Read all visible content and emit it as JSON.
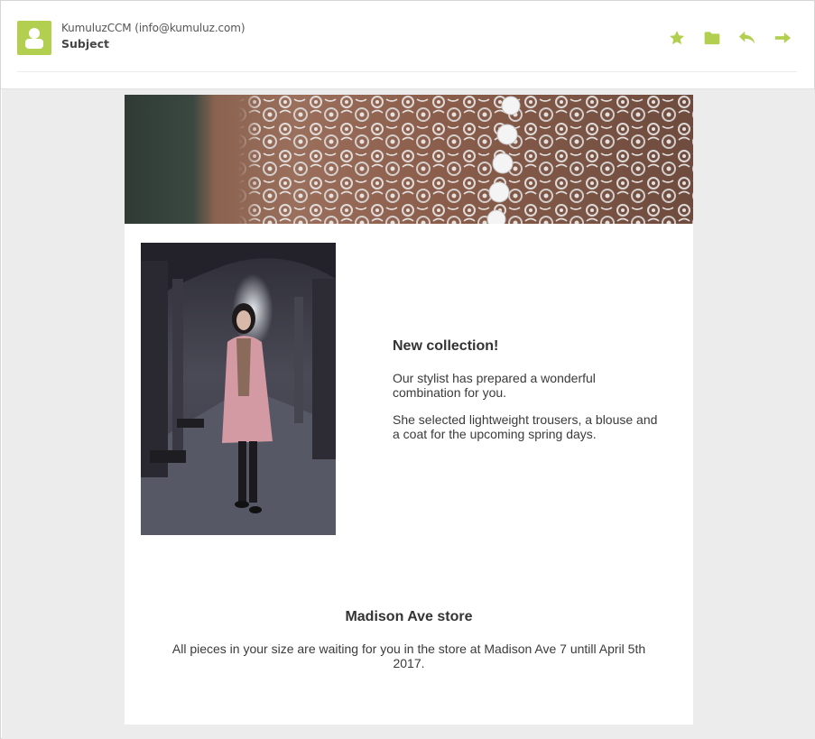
{
  "header": {
    "sender": "KumuluzCCM (info@kumuluz.com)",
    "subject": "Subject",
    "actions": [
      {
        "icon": "star-icon"
      },
      {
        "icon": "folder-icon"
      },
      {
        "icon": "reply-icon"
      },
      {
        "icon": "forward-icon"
      }
    ]
  },
  "colors": {
    "accent": "#b3cf4f",
    "background": "#ececec"
  },
  "email": {
    "collection": {
      "title": "New collection!",
      "paragraphs": [
        "Our stylist has prepared a wonderful combination for you.",
        "She selected lightweight trousers, a blouse and a coat for the upcoming spring days."
      ]
    },
    "store": {
      "title": "Madison Ave store",
      "text": "All pieces in your size are waiting for you in the store at Madison Ave 7 untill April 5th 2017."
    }
  }
}
